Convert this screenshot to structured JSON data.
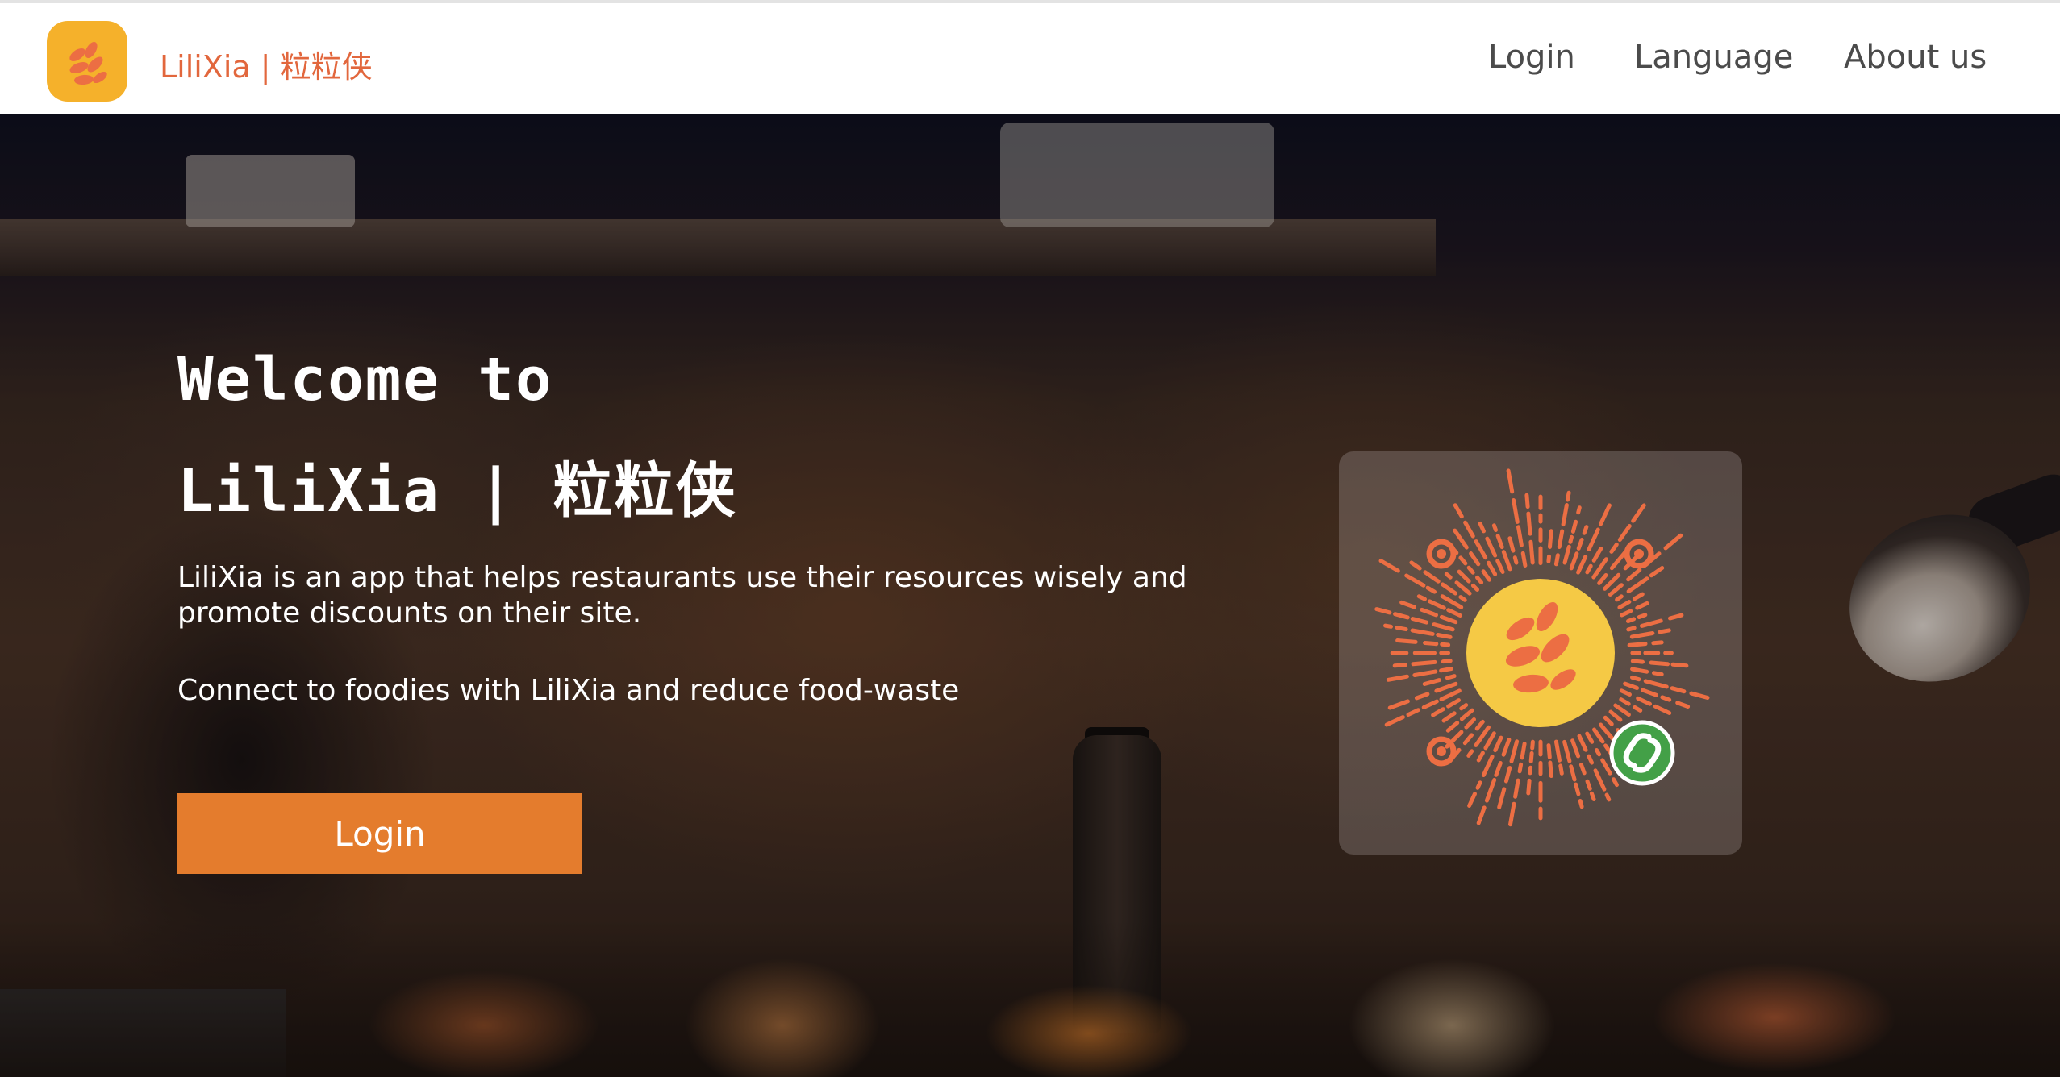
{
  "navbar": {
    "brand_name": "LiliXia | 粒粒侠",
    "links": [
      "Login",
      "Language",
      "About us"
    ]
  },
  "hero": {
    "title_line1": "Welcome to",
    "title_line2": "LiliXia | 粒粒侠",
    "description": "LiliXia is an app that helps restaurants use their resources wisely and promote discounts on their site.",
    "tagline": "Connect to foodies with LiliXia and reduce food-waste",
    "login_button": "Login"
  },
  "qr": {
    "icon": "mini-program-code-icon",
    "badge_icon": "link-icon"
  },
  "colors": {
    "brand_orange": "#e2673d",
    "logo_yellow": "#f5b12b",
    "button_orange": "#e47c2d",
    "leaf_orange": "#ec6e43",
    "badge_green": "#43a047"
  }
}
